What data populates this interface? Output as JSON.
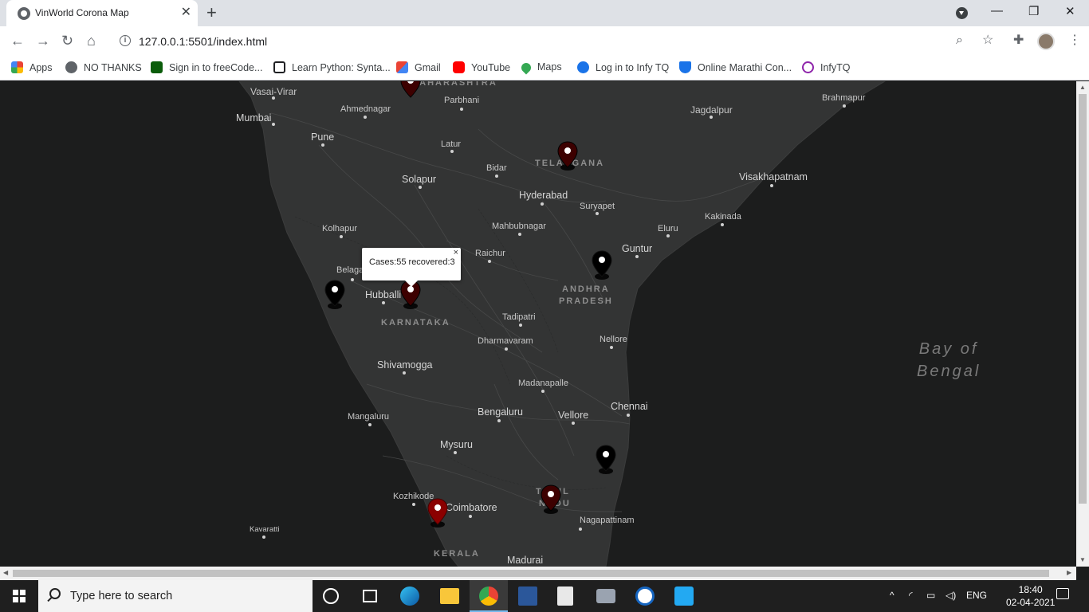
{
  "browser": {
    "tab_title": "VinWorld Corona Map",
    "tab_close": "✕",
    "new_tab": "+",
    "url": "127.0.0.1:5501/index.html",
    "info_icon": "i",
    "window_controls": {
      "minimize": "—",
      "maximize": "❐",
      "close": "✕"
    }
  },
  "bookmarks": [
    {
      "label": "Apps",
      "icon": "apps-grid-icon",
      "color": "#ea4335"
    },
    {
      "label": "NO THANKS",
      "icon": "globe-icon",
      "color": "#5f6368"
    },
    {
      "label": "Sign in to freeCode...",
      "icon": "freecodecamp-icon",
      "color": "#0a5c0a"
    },
    {
      "label": "Learn Python: Synta...",
      "icon": "codecademy-icon",
      "color": "#202124"
    },
    {
      "label": "Gmail",
      "icon": "gmail-icon",
      "color": "#ea4335"
    },
    {
      "label": "YouTube",
      "icon": "youtube-icon",
      "color": "#ff0000"
    },
    {
      "label": "Maps",
      "icon": "maps-pin-icon",
      "color": "#34a853"
    },
    {
      "label": "Log in to Infy TQ",
      "icon": "infy-icon",
      "color": "#1a73e8"
    },
    {
      "label": "Online Marathi Con...",
      "icon": "shield-icon",
      "color": "#1a73e8"
    },
    {
      "label": "InfyTQ",
      "icon": "infytq-icon",
      "color": "#8e24aa"
    }
  ],
  "map": {
    "cities": [
      {
        "name": "Vasai-Virar",
        "size": "small"
      },
      {
        "name": "Mumbai",
        "size": "big"
      },
      {
        "name": "Ahmednagar",
        "size": "small"
      },
      {
        "name": "Parbhani",
        "size": "small"
      },
      {
        "name": "Jagdalpur",
        "size": "small"
      },
      {
        "name": "Brahmapur",
        "size": "small"
      },
      {
        "name": "Pune",
        "size": "big"
      },
      {
        "name": "Latur",
        "size": "small"
      },
      {
        "name": "Bidar",
        "size": "small"
      },
      {
        "name": "Solapur",
        "size": "big"
      },
      {
        "name": "Hyderabad",
        "size": "big"
      },
      {
        "name": "Suryapet",
        "size": "small"
      },
      {
        "name": "Visakhapatnam",
        "size": "big"
      },
      {
        "name": "Kakinada",
        "size": "small"
      },
      {
        "name": "Kolhapur",
        "size": "small"
      },
      {
        "name": "Mahbubnagar",
        "size": "small"
      },
      {
        "name": "Eluru",
        "size": "small"
      },
      {
        "name": "Guntur",
        "size": "big"
      },
      {
        "name": "Raichur",
        "size": "small"
      },
      {
        "name": "Belaga",
        "size": "small"
      },
      {
        "name": "Hubballi",
        "size": "big"
      },
      {
        "name": "Tadipatri",
        "size": "small"
      },
      {
        "name": "Dharmavaram",
        "size": "small"
      },
      {
        "name": "Nellore",
        "size": "small"
      },
      {
        "name": "Shivamogga",
        "size": "big"
      },
      {
        "name": "Madanapalle",
        "size": "small"
      },
      {
        "name": "Mangaluru",
        "size": "small"
      },
      {
        "name": "Bengaluru",
        "size": "big"
      },
      {
        "name": "Vellore",
        "size": "big"
      },
      {
        "name": "Chennai",
        "size": "big"
      },
      {
        "name": "Mysuru",
        "size": "big"
      },
      {
        "name": "Kozhikode",
        "size": "small"
      },
      {
        "name": "Coimbatore",
        "size": "big"
      },
      {
        "name": "Nagapattinam",
        "size": "small"
      },
      {
        "name": "Kavaratti",
        "size": "small"
      },
      {
        "name": "Madurai",
        "size": "big"
      }
    ],
    "regions": [
      "MAHARASHTRA",
      "TELANGANA",
      "ANDHRA",
      "PRADESH",
      "KARNATAKA",
      "TAMIL",
      "NADU",
      "KERALA"
    ],
    "sea_label": [
      "Bay of",
      "Bengal"
    ],
    "marker_colors": {
      "black": "#000000",
      "dark_red": "#3d0000",
      "red": "#8b0000"
    },
    "popup": {
      "text": "Cases:55 recovered:3",
      "close": "×"
    }
  },
  "taskbar": {
    "search_placeholder": "Type here to search",
    "apps": [
      "cortana-icon",
      "task-view-icon",
      "edge-icon",
      "file-explorer-icon",
      "chrome-icon",
      "word-icon",
      "document-icon",
      "camera-icon",
      "app-icon",
      "vscode-icon"
    ],
    "tray": {
      "chevron": "^",
      "language": "ENG"
    },
    "time": "18:40",
    "date": "02-04-2021"
  }
}
